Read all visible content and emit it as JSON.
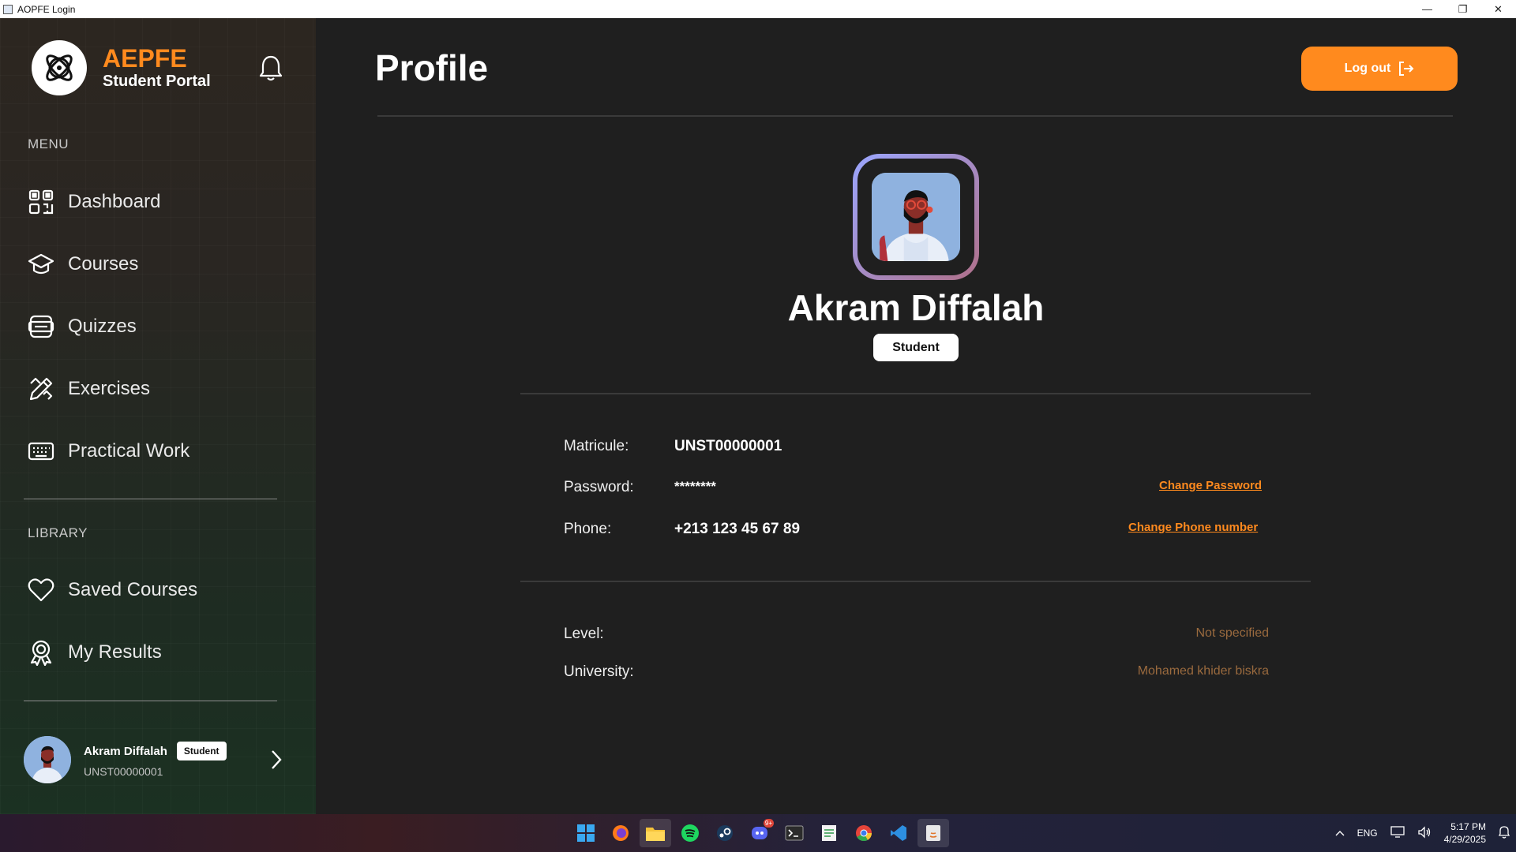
{
  "window": {
    "title": "AOPFE Login",
    "minimize": "—",
    "restore": "❐",
    "close": "✕"
  },
  "brand": {
    "name": "AEPFE",
    "subtitle": "Student Portal"
  },
  "sidebar": {
    "menu_label": "MENU",
    "menu_items": [
      {
        "label": "Dashboard",
        "icon": "dashboard-grid-icon"
      },
      {
        "label": "Courses",
        "icon": "graduation-cap-icon"
      },
      {
        "label": "Quizzes",
        "icon": "quiz-icon"
      },
      {
        "label": "Exercises",
        "icon": "pencil-ruler-icon"
      },
      {
        "label": "Practical Work",
        "icon": "keyboard-icon"
      }
    ],
    "library_label": "LIBRARY",
    "library_items": [
      {
        "label": "Saved Courses",
        "icon": "heart-icon"
      },
      {
        "label": "My Results",
        "icon": "award-icon"
      }
    ],
    "user": {
      "name": "Akram Diffalah",
      "role": "Student",
      "id": "UNST00000001"
    }
  },
  "main": {
    "title": "Profile",
    "logout_label": "Log out",
    "profile": {
      "name": "Akram Diffalah",
      "role": "Student"
    },
    "details": {
      "matricule_label": "Matricule:",
      "matricule_value": "UNST00000001",
      "password_label": "Password:",
      "password_value": "********",
      "change_password": "Change Password",
      "phone_label": "Phone:",
      "phone_value": "+213 123 45 67 89",
      "change_phone": "Change Phone number",
      "level_label": "Level:",
      "level_value": "Not specified",
      "university_label": "University:",
      "university_value": "Mohamed khider biskra"
    }
  },
  "taskbar": {
    "language": "ENG",
    "time": "5:17 PM",
    "date": "4/29/2025",
    "discord_badge": "9+"
  },
  "colors": {
    "accent": "#ff8a1e",
    "background": "#1f1f1f"
  }
}
